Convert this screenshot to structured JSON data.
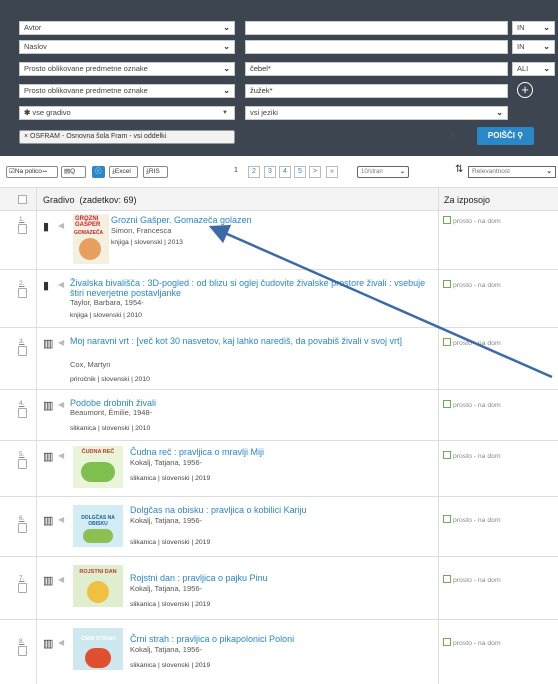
{
  "filters": {
    "rows": [
      {
        "field": "Avtor",
        "value": "",
        "op": "IN"
      },
      {
        "field": "Naslov",
        "value": "",
        "op": "IN"
      },
      {
        "field": "Prosto oblikovane predmetne oznake",
        "value": "čebel*",
        "op": "ALI"
      },
      {
        "field": "Prosto oblikovane predmetne oznake",
        "value": "žužek*",
        "op": ""
      }
    ],
    "material": "vse gradivo",
    "language": "vsi jeziki",
    "chip": "× OSFRAM - Osnovna šola Fram - vsi oddelki",
    "clear": "×",
    "search_label": "POIŠČI"
  },
  "toolbar": {
    "shelf": "Na policoꕀ",
    "excel": "Excel",
    "ris": "RIS",
    "pages": [
      "1",
      "2",
      "3",
      "4",
      "5",
      ">",
      "»"
    ],
    "per_page": "10/stran",
    "sort": "Relevantnost"
  },
  "table": {
    "col_material": "Gradivo",
    "count": "(zadetkov: 69)",
    "col_loan": "Za izposojo"
  },
  "results": [
    {
      "num": "1.",
      "title": "Grozni Gašper. Gomazeča golazen",
      "author": "Simon, Francesca",
      "meta": "knjiga | slovenski | 2013",
      "loan": "prosto - na dom",
      "cover": "red"
    },
    {
      "num": "2.",
      "title": "Živalska bivališča : 3D-pogled : od blizu si oglej čudovite živalske prostore živali : vsebuje štiri neverjetne postavljanke",
      "author": "Taylor, Barbara, 1954-",
      "meta": "knjiga | slovenski | 2010",
      "loan": "prosto - na dom",
      "cover": ""
    },
    {
      "num": "3.",
      "title": "Moj naravni vrt : [več kot 30 nasvetov, kaj lahko narediš, da povabiš živali v svoj vrt]",
      "author": "Cox, Martyn",
      "meta": "priročnik | slovenski | 2010",
      "loan": "prosto - na dom",
      "cover": ""
    },
    {
      "num": "4.",
      "title": "Podobe drobnih živali",
      "author": "Beaumont, Émilie, 1948-",
      "meta": "slikanica | slovenski | 2010",
      "loan": "prosto - na dom",
      "cover": ""
    },
    {
      "num": "5.",
      "title": "Čudna reč : pravljica o mravlji Miji",
      "author": "Kokalj, Tatjana, 1956-",
      "meta": "slikanica | slovenski | 2019",
      "loan": "prosto - na dom",
      "cover": "ČUDNA REČ"
    },
    {
      "num": "6.",
      "title": "Dolgčas na obisku : pravljica o kobilici Kariju",
      "author": "Kokalj, Tatjana, 1956-",
      "meta": "slikanica | slovenski | 2019",
      "loan": "prosto - na dom",
      "cover": "DOLGČAS NA OBISKU"
    },
    {
      "num": "7.",
      "title": "Rojstni dan : pravljica o pajku Pinu",
      "author": "Kokalj, Tatjana, 1956-",
      "meta": "slikanica | slovenski | 2019",
      "loan": "prosto - na dom",
      "cover": "ROJSTNI DAN"
    },
    {
      "num": "8.",
      "title": "Črni strah : pravljica o pikapolonici Poloni",
      "author": "Kokalj, Tatjana, 1956-",
      "meta": "slikanica | slovenski | 2019",
      "loan": "prosto - na dom",
      "cover": "ČRNI STRAH"
    }
  ],
  "cover1": {
    "line1": "GROZNI",
    "line2": "GAŠPER",
    "line3": "GOMAZEČA"
  },
  "colors": {
    "panel": "#3d4650",
    "accent": "#2a88c8",
    "available": "#6ab04c"
  }
}
